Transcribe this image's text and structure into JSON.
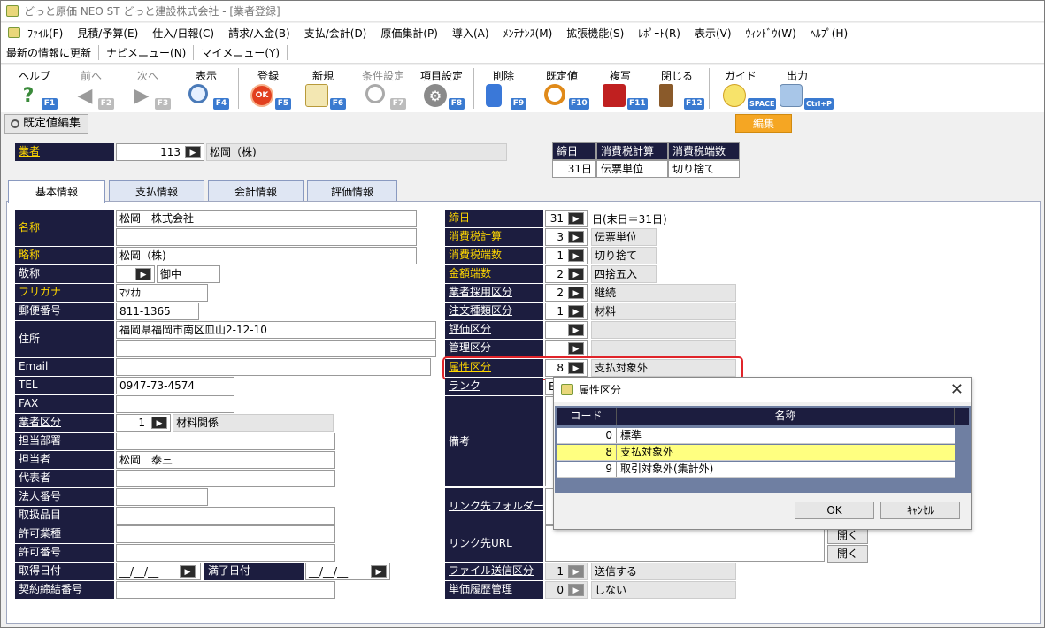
{
  "window_title": "どっと原価 NEO ST どっと建設株式会社 - [業者登録]",
  "menu": [
    "ﾌｧｲﾙ(F)",
    "見積/予算(E)",
    "仕入/日報(C)",
    "請求/入金(B)",
    "支払/会計(D)",
    "原価集計(P)",
    "導入(A)",
    "ﾒﾝﾃﾅﾝｽ(M)",
    "拡張機能(S)",
    "ﾚﾎﾟｰﾄ(R)",
    "表示(V)",
    "ｳｨﾝﾄﾞｳ(W)",
    "ﾍﾙﾌﾟ(H)"
  ],
  "commands": [
    "最新の情報に更新",
    "ナビメニュー(N)",
    "マイメニュー(Y)"
  ],
  "toolbar": [
    {
      "label": "ヘルプ",
      "key": "F1",
      "icon": "help-icon",
      "enabled": true
    },
    {
      "label": "前へ",
      "key": "F2",
      "icon": "arrow-left-icon",
      "enabled": false
    },
    {
      "label": "次へ",
      "key": "F3",
      "icon": "arrow-right-icon",
      "enabled": false
    },
    {
      "label": "表示",
      "key": "F4",
      "icon": "magnifier-icon",
      "enabled": true
    },
    {
      "label": "登録",
      "key": "F5",
      "icon": "ok-icon",
      "enabled": true
    },
    {
      "label": "新規",
      "key": "F6",
      "icon": "new-document-icon",
      "enabled": true
    },
    {
      "label": "条件設定",
      "key": "F7",
      "icon": "filter-search-icon",
      "enabled": false
    },
    {
      "label": "項目設定",
      "key": "F8",
      "icon": "settings-gear-icon",
      "enabled": true
    },
    {
      "label": "削除",
      "key": "F9",
      "icon": "trash-icon",
      "enabled": true
    },
    {
      "label": "既定値",
      "key": "F10",
      "icon": "refresh-icon",
      "enabled": true
    },
    {
      "label": "複写",
      "key": "F11",
      "icon": "copy-lock-icon",
      "enabled": true
    },
    {
      "label": "閉じる",
      "key": "F12",
      "icon": "exit-door-icon",
      "enabled": true
    },
    {
      "label": "ガイド",
      "key": "SPACE",
      "icon": "lightbulb-icon",
      "enabled": true
    },
    {
      "label": "出力",
      "key": "Ctrl+P",
      "icon": "printer-icon",
      "enabled": true
    }
  ],
  "default_edit_button": "既定値編集",
  "edit_badge": "編集",
  "vendor": {
    "label": "業者",
    "code": "113",
    "name": "松岡（株)"
  },
  "header_table": {
    "headers": [
      "締日",
      "消費税計算",
      "消費税端数"
    ],
    "values": [
      "31日",
      "伝票単位",
      "切り捨て"
    ]
  },
  "tabs": [
    "基本情報",
    "支払情報",
    "会計情報",
    "評価情報"
  ],
  "left": {
    "name_label": "名称",
    "name1": "松岡　株式会社",
    "name2": "",
    "short_label": "略称",
    "short": "松岡（株)",
    "honorific_label": "敬称",
    "honorific": "御中",
    "kana_label": "フリガナ",
    "kana": "ﾏﾂｵｶ",
    "zip_label": "郵便番号",
    "zip": "811-1365",
    "address_label": "住所",
    "address1": "福岡県福岡市南区皿山2-12-10",
    "address2": "",
    "email_label": "Email",
    "email": "",
    "tel_label": "TEL",
    "tel": "0947-73-4574",
    "fax_label": "FAX",
    "fax": "",
    "vendor_type_label": "業者区分",
    "vendor_type_code": "1",
    "vendor_type": "材料関係",
    "dept_label": "担当部署",
    "dept": "",
    "person_label": "担当者",
    "person": "松岡　泰三",
    "rep_label": "代表者",
    "rep": "",
    "corp_no_label": "法人番号",
    "corp_no": "",
    "items_label": "取扱品目",
    "items": "",
    "license_type_label": "許可業種",
    "license_type": "",
    "license_no_label": "許可番号",
    "license_no": "",
    "acq_date_label": "取得日付",
    "acq_date": "__/__/__",
    "exp_date_label": "満了日付",
    "exp_date": "__/__/__",
    "contract_label": "契約締結番号",
    "contract": ""
  },
  "right": {
    "closing_label": "締日",
    "closing": "31",
    "closing_note": "日(末日＝31日)",
    "tax_calc_label": "消費税計算",
    "tax_calc_code": "3",
    "tax_calc": "伝票単位",
    "tax_round_label": "消費税端数",
    "tax_round_code": "1",
    "tax_round": "切り捨て",
    "amount_round_label": "金額端数",
    "amount_round_code": "2",
    "amount_round": "四捨五入",
    "adopt_label": "業者採用区分",
    "adopt_code": "2",
    "adopt": "継続",
    "order_type_label": "注文種類区分",
    "order_type_code": "1",
    "order_type": "材料",
    "eval_label": "評価区分",
    "eval_code": "",
    "eval": "",
    "mgmt_label": "管理区分",
    "mgmt_code": "",
    "mgmt": "",
    "attr_label": "属性区分",
    "attr_code": "8",
    "attr": "支払対象外",
    "rank_label": "ランク",
    "rank_code": "E",
    "remarks_label": "備考",
    "link_folder_label": "リンク先フォルダー",
    "link_url_label": "リンク先URL",
    "open_label": "開く",
    "file_send_label": "ファイル送信区分",
    "file_send_code": "1",
    "file_send": "送信する",
    "price_hist_label": "単価履歴管理",
    "price_hist_code": "0",
    "price_hist": "しない"
  },
  "dialog": {
    "title": "属性区分",
    "col_code": "コード",
    "col_name": "名称",
    "rows": [
      {
        "code": "0",
        "name": "標準"
      },
      {
        "code": "8",
        "name": "支払対象外"
      },
      {
        "code": "9",
        "name": "取引対象外(集計外)"
      }
    ],
    "selected_code": "8",
    "ok": "OK",
    "cancel": "ｷｬﾝｾﾙ"
  },
  "colors": {
    "label_bg": "#1c1d3f",
    "label_link": "#ffd700",
    "highlight": "#ffff80",
    "accent_red": "#e0242a",
    "edit_badge": "#f5a623"
  }
}
